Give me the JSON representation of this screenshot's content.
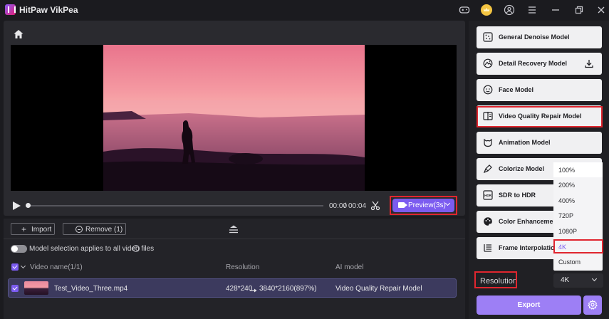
{
  "app": {
    "title": "HitPaw VikPea"
  },
  "player": {
    "time_current": "00:00",
    "time_separator": "/",
    "time_total": "00:04",
    "progress": 0,
    "preview_label": "Preview(3s)"
  },
  "files_toolbar": {
    "import_label": "Import",
    "remove_label": "Remove (1)"
  },
  "model_selection": {
    "toggle_label": "Model selection applies to all video files",
    "toggle_on": false
  },
  "file_table": {
    "columns": [
      "Video name(1/1)",
      "Resolution",
      "AI model"
    ],
    "rows": [
      {
        "name": "Test_Video_Three.mp4",
        "resolution_from": "428*240",
        "resolution_to": "3840*2160(897%)",
        "model": "Video Quality Repair Model",
        "checked": true
      }
    ]
  },
  "models": [
    {
      "label": "General Denoise Model",
      "icon": "denoise-icon"
    },
    {
      "label": "Detail Recovery Model",
      "icon": "detail-recovery-icon",
      "download": true
    },
    {
      "label": "Face Model",
      "icon": "face-icon"
    },
    {
      "label": "Video Quality Repair Model",
      "icon": "video-repair-icon",
      "selected": true
    },
    {
      "label": "Animation Model",
      "icon": "animation-icon"
    },
    {
      "label": "Colorize Model",
      "icon": "colorize-icon"
    },
    {
      "label": "SDR to HDR",
      "icon": "hdr-icon"
    },
    {
      "label": "Color Enhancement",
      "icon": "color-enhance-icon"
    },
    {
      "label": "Frame Interpolation",
      "icon": "frame-interp-icon"
    }
  ],
  "resolution": {
    "label": "Resolution",
    "value": "4K",
    "options": [
      "100%",
      "200%",
      "400%",
      "720P",
      "1080P",
      "4K",
      "Custom"
    ],
    "selected_index": 5
  },
  "export": {
    "label": "Export"
  },
  "colors": {
    "accent": "#7c5cf0",
    "highlight": "#e0262f",
    "background": "#1b1b1f"
  }
}
